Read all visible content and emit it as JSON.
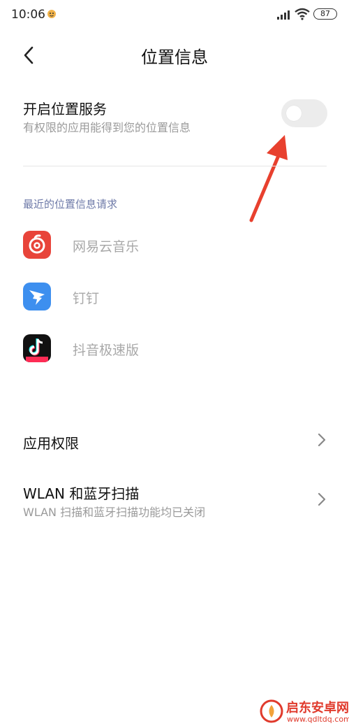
{
  "status_bar": {
    "time": "10:06",
    "battery": "87",
    "icons": [
      "app-notification-icon",
      "signal-icon",
      "wifi-icon",
      "battery-icon"
    ]
  },
  "header": {
    "back_icon": "chevron-left-icon",
    "title": "位置信息"
  },
  "location_service": {
    "title": "开启位置服务",
    "subtitle": "有权限的应用能得到您的位置信息",
    "enabled": false
  },
  "recent_requests": {
    "header": "最近的位置信息请求",
    "apps": [
      {
        "name": "网易云音乐",
        "icon": "netease-music-icon",
        "color": "#e8443a"
      },
      {
        "name": "钉钉",
        "icon": "dingtalk-icon",
        "color": "#3d8fef"
      },
      {
        "name": "抖音极速版",
        "icon": "douyin-lite-icon",
        "color": "#111111"
      }
    ]
  },
  "settings": [
    {
      "title": "应用权限",
      "subtitle": ""
    },
    {
      "title": "WLAN 和蓝牙扫描",
      "subtitle": "WLAN 扫描和蓝牙扫描功能均已关闭"
    }
  ],
  "annotation": {
    "icon": "red-arrow-icon",
    "color": "#e8402e"
  },
  "watermark": {
    "name": "启东安卓网",
    "url": "www.qdltdq.com",
    "color": "#e03a2c"
  }
}
